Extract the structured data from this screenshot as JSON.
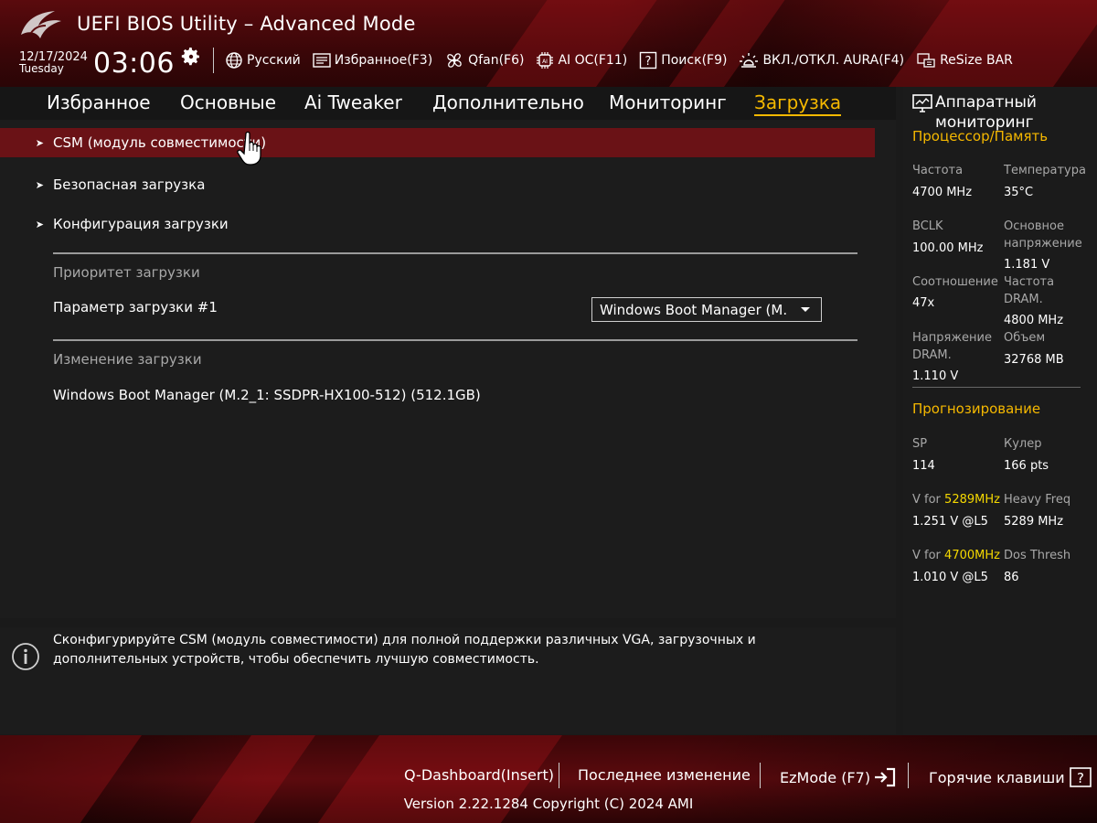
{
  "header": {
    "title": "UEFI BIOS Utility – Advanced Mode",
    "date": "12/17/2024",
    "weekday": "Tuesday",
    "time": "03:06",
    "tools": [
      {
        "icon": "globe-icon",
        "label": "Русский"
      },
      {
        "icon": "favorites-icon",
        "label": "Избранное(F3)"
      },
      {
        "icon": "fan-icon",
        "label": "Qfan(F6)"
      },
      {
        "icon": "ai-chip-icon",
        "label": "AI OC(F11)"
      },
      {
        "icon": "help-box-icon",
        "label": "Поиск(F9)"
      },
      {
        "icon": "aura-light-icon",
        "label": "ВКЛ./ОТКЛ. AURA(F4)"
      },
      {
        "icon": "resize-bar-icon",
        "label": "ReSize BAR"
      }
    ]
  },
  "tabs": [
    {
      "label": "Избранное"
    },
    {
      "label": "Основные"
    },
    {
      "label": "Ai Tweaker"
    },
    {
      "label": "Дополнительно"
    },
    {
      "label": "Мониторинг"
    },
    {
      "label": "Загрузка",
      "active": true
    }
  ],
  "main": {
    "menu_items": [
      {
        "label": "CSM (модуль совместимости)"
      },
      {
        "label": "Безопасная загрузка"
      },
      {
        "label": "Конфигурация загрузки"
      }
    ],
    "boot_priority_label": "Приоритет загрузки",
    "boot_option_label": "Параметр загрузки #1",
    "boot_option_value": "Windows Boot Manager (M.",
    "boot_override_label": "Изменение загрузки",
    "boot_override_item": "Windows Boot Manager (M.2_1: SSDPR-HX100-512) (512.1GB)"
  },
  "help": {
    "text": "Сконфигурируйте CSM (модуль совместимости) для полной поддержки различных VGA, загрузочных и дополнительных устройств, чтобы обеспечить лучшую совместимость."
  },
  "monitor": {
    "title_line1": "Аппаратный",
    "title_line2": "мониторинг",
    "cpu_section": "Процессор/Память",
    "freq_label": "Частота",
    "freq_value": "4700 MHz",
    "temp_label": "Температура",
    "temp_value": "35°C",
    "bclk_label": "BCLK",
    "bclk_value": "100.00 MHz",
    "vcore_label_1": "Основное",
    "vcore_label_2": "напряжение",
    "vcore_value": "1.181 V",
    "ratio_label": "Соотношение",
    "ratio_value": "47x",
    "dramfreq_label_1": "Частота",
    "dramfreq_label_2": "DRAM.",
    "dramfreq_value": "4800 MHz",
    "dramv_label_1": "Напряжение",
    "dramv_label_2": "DRAM.",
    "dramv_value": "1.110 V",
    "capacity_label": "Объем",
    "capacity_value": "32768 MB",
    "prediction_section": "Прогнозирование",
    "sp_label": "SP",
    "sp_value": "114",
    "cooler_label": "Кулер",
    "cooler_value": "166 pts",
    "vfor1_prefix": "V for ",
    "vfor1_freq": "5289MHz",
    "vfor1_value": "1.251 V @L5",
    "heavy_label": "Heavy Freq",
    "heavy_value": "5289 MHz",
    "vfor2_prefix": "V for ",
    "vfor2_freq": "4700MHz",
    "vfor2_value": "1.010 V @L5",
    "dos_label": "Dos Thresh",
    "dos_value": "86"
  },
  "footer": {
    "qdashboard": "Q-Dashboard(Insert)",
    "last_change": "Последнее изменение",
    "ezmode": "EzMode (F7)",
    "hotkeys": "Горячие клавиши",
    "version": "Version 2.22.1284 Copyright (C) 2024 AMI"
  },
  "colors": {
    "accent": "#f5b800",
    "selected_row": "#6a1216",
    "header_red": "#5a0a0d"
  }
}
